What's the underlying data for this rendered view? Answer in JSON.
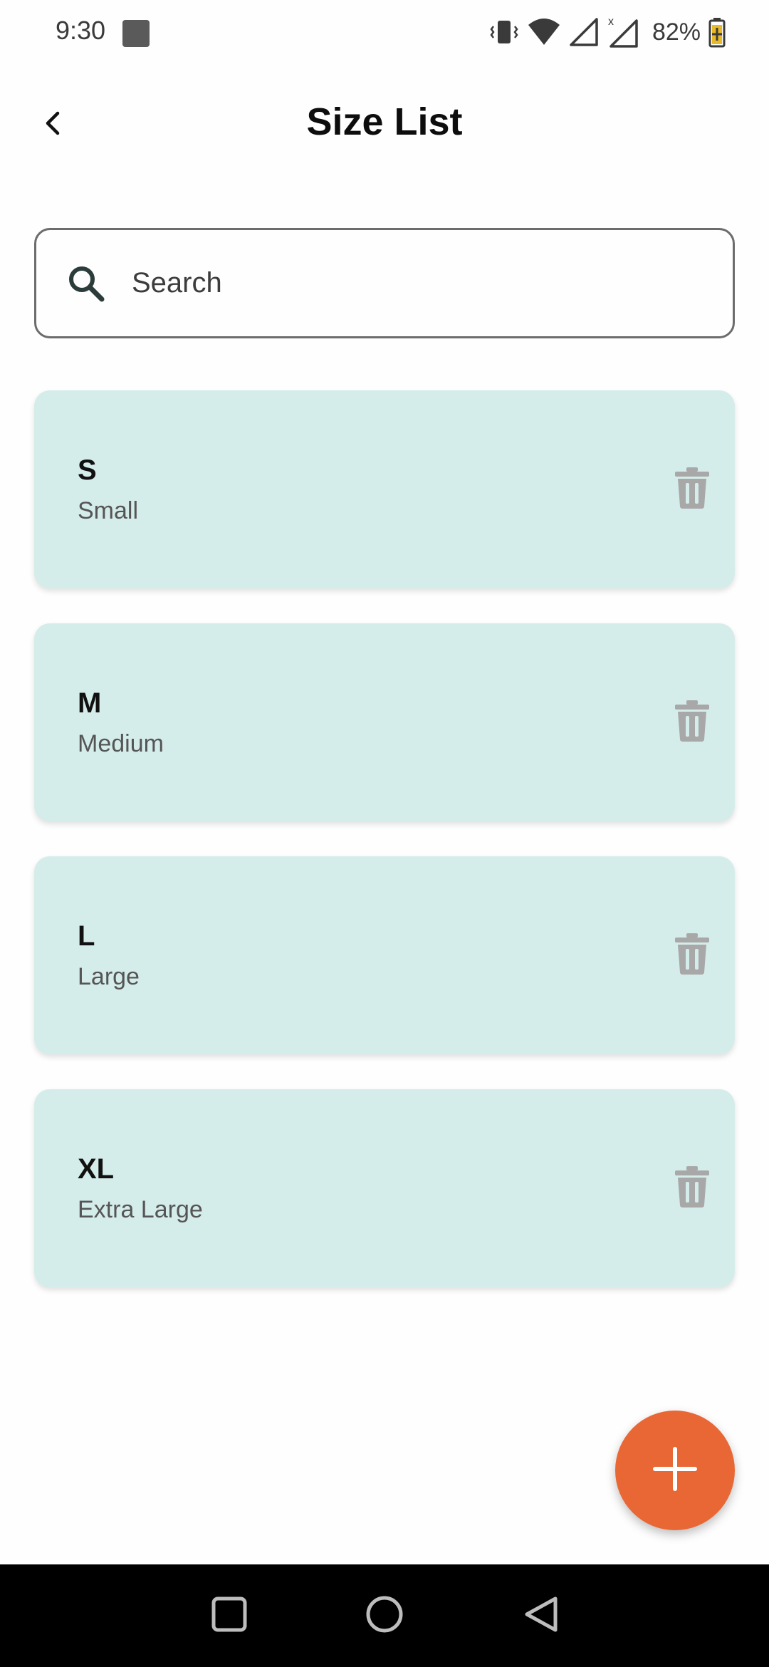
{
  "status_bar": {
    "time": "9:30",
    "battery_percent": "82%",
    "icons": [
      "vibrate-icon",
      "wifi-icon",
      "signal-icon",
      "signal-no-data-icon",
      "battery-charging-icon"
    ]
  },
  "app_bar": {
    "title": "Size List",
    "back_icon": "chevron-left-icon"
  },
  "search": {
    "placeholder": "Search",
    "value": "",
    "icon": "search-icon"
  },
  "sizes": [
    {
      "code": "S",
      "name": "Small"
    },
    {
      "code": "M",
      "name": "Medium"
    },
    {
      "code": "L",
      "name": "Large"
    },
    {
      "code": "XL",
      "name": "Extra Large"
    }
  ],
  "fab": {
    "icon": "plus-icon"
  },
  "colors": {
    "card_background": "#d5edea",
    "fab_background": "#e86734",
    "delete_icon": "#a8a8a8",
    "nav_bar": "#000000"
  },
  "nav_bar": {
    "buttons": [
      "recents-icon",
      "home-icon",
      "back-triangle-icon"
    ]
  }
}
